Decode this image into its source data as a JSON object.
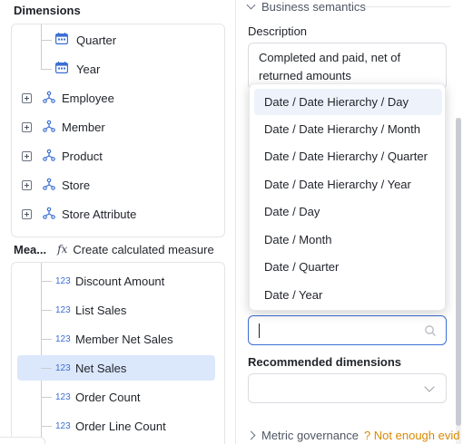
{
  "dimensions": {
    "title": "Dimensions",
    "children": [
      {
        "label": "Quarter",
        "icon": "calendar-icon"
      },
      {
        "label": "Year",
        "icon": "calendar-icon"
      }
    ],
    "groups": [
      {
        "label": "Employee",
        "icon": "hierarchy-icon"
      },
      {
        "label": "Member",
        "icon": "hierarchy-icon"
      },
      {
        "label": "Product",
        "icon": "hierarchy-icon"
      },
      {
        "label": "Store",
        "icon": "hierarchy-icon"
      },
      {
        "label": "Store Attribute",
        "icon": "hierarchy-icon"
      }
    ]
  },
  "measures": {
    "title": "Mea...",
    "fx": "fx",
    "create_label": "Create calculated measure",
    "number_tag": "123",
    "items": [
      {
        "label": "Discount Amount",
        "selected": false
      },
      {
        "label": "List Sales",
        "selected": false
      },
      {
        "label": "Member Net Sales",
        "selected": false
      },
      {
        "label": "Net Sales",
        "selected": true
      },
      {
        "label": "Order Count",
        "selected": false
      },
      {
        "label": "Order Line Count",
        "selected": false
      }
    ]
  },
  "right": {
    "business_semantics": "Business semantics",
    "description_label": "Description",
    "description_value": "Completed and paid, net of returned amounts",
    "search_value": "",
    "recommended_label": "Recommended dimensions",
    "governance_label": "Metric governance",
    "governance_warning": "? Not enough evid"
  },
  "dropdown": {
    "options": [
      {
        "label": "Date / Date Hierarchy / Day",
        "active": true
      },
      {
        "label": "Date / Date Hierarchy / Month",
        "active": false
      },
      {
        "label": "Date / Date Hierarchy / Quarter",
        "active": false
      },
      {
        "label": "Date / Date Hierarchy / Year",
        "active": false
      },
      {
        "label": "Date / Day",
        "active": false
      },
      {
        "label": "Date / Month",
        "active": false
      },
      {
        "label": "Date / Quarter",
        "active": false
      },
      {
        "label": "Date / Year",
        "active": false
      }
    ]
  },
  "colors": {
    "accent": "#3b6fd4",
    "selected_row": "#dbe7fb",
    "warning": "#d98a00"
  }
}
